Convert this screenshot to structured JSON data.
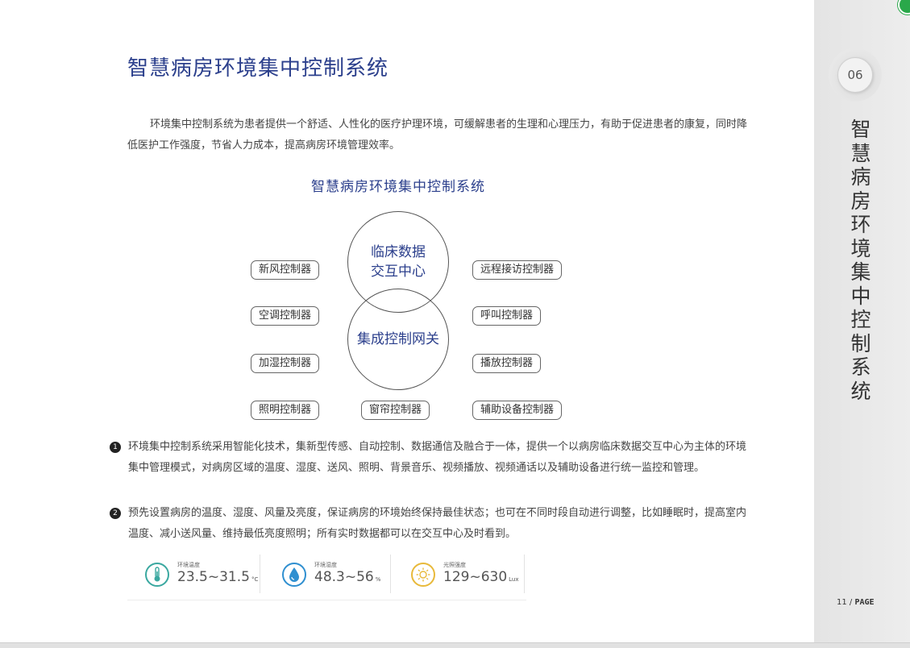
{
  "title": "智慧病房环境集中控制系统",
  "intro": "环境集中控制系统为患者提供一个舒适、人性化的医疗护理环境，可缓解患者的生理和心理压力，有助于促进患者的康复，同时降低医护工作强度，节省人力成本，提高病房环境管理效率。",
  "diagram": {
    "title": "智慧病房环境集中控制系统",
    "circle_top": [
      "临床数据",
      "交互中心"
    ],
    "circle_bottom": "集成控制网关",
    "left": [
      "新风控制器",
      "空调控制器",
      "加湿控制器",
      "照明控制器"
    ],
    "bottom_center": "窗帘控制器",
    "right": [
      "远程接访控制器",
      "呼叫控制器",
      "播放控制器",
      "辅助设备控制器"
    ]
  },
  "bullets": [
    {
      "num": "1",
      "text": "环境集中控制系统采用智能化技术，集新型传感、自动控制、数据通信及融合于一体，提供一个以病房临床数据交互中心为主体的环境集中管理模式，对病房区域的温度、湿度、送风、照明、背景音乐、视频播放、视频通话以及辅助设备进行统一监控和管理。"
    },
    {
      "num": "2",
      "text": "预先设置病房的温度、湿度、风量及亮度，保证病房的环境始终保持最佳状态；也可在不同时段自动进行调整，比如睡眠时，提高室内温度、减小送风量、维持最低亮度照明；所有实时数据都可以在交互中心及时看到。"
    }
  ],
  "stats": [
    {
      "label": "环境温度",
      "value": "23.5~31.5",
      "unit": "°C",
      "icon": "thermometer-icon",
      "color": "#3aa8a0"
    },
    {
      "label": "环境湿度",
      "value": "48.3~56",
      "unit": "%",
      "icon": "water-drop-icon",
      "color": "#2f8fd0"
    },
    {
      "label": "光照强度",
      "value": "129~630",
      "unit": "Lux",
      "icon": "sun-icon",
      "color": "#e8b93a"
    }
  ],
  "sidebar": {
    "section_number": "06",
    "vertical_title": "智慧病房环境集中控制系统",
    "page_number": "11",
    "page_label": "PAGE"
  }
}
